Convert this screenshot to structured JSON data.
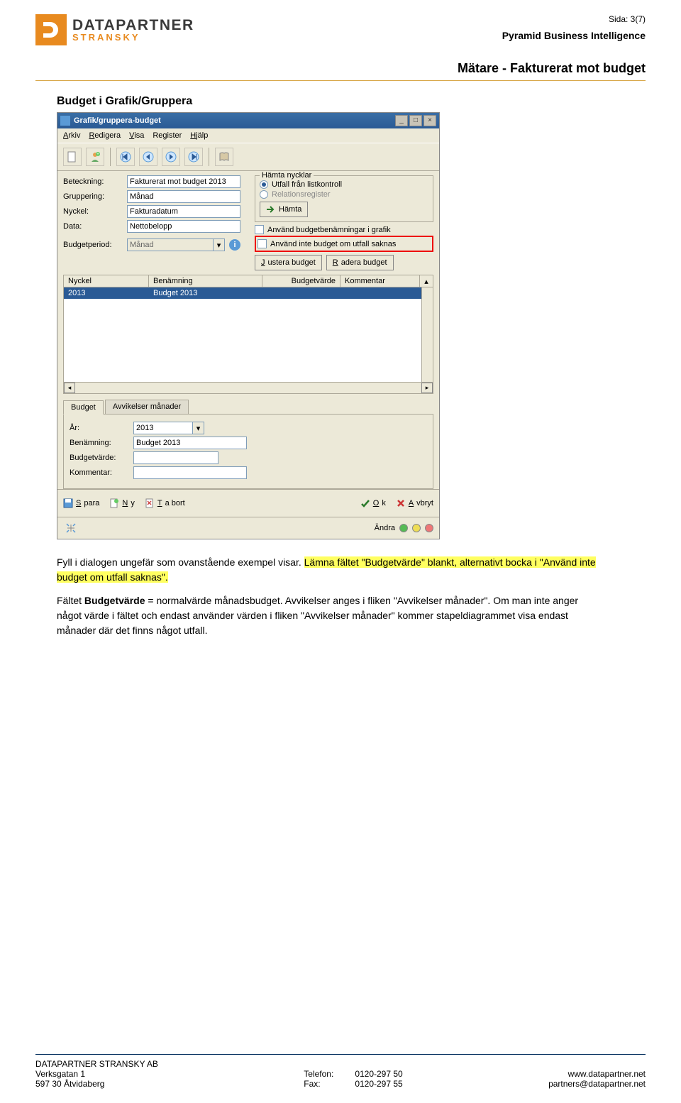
{
  "page": {
    "number": "Sida: 3(7)",
    "group": "Pyramid Business Intelligence",
    "title": "Mätare - Fakturerat mot budget"
  },
  "logo": {
    "main": "DATAPARTNER",
    "sub": "STRANSKY"
  },
  "section_title": "Budget i Grafik/Gruppera",
  "window": {
    "title": "Grafik/gruppera-budget",
    "menus": {
      "arkiv": "Arkiv",
      "redigera": "Redigera",
      "visa": "Visa",
      "register": "Register",
      "hjalp": "Hjälp"
    },
    "form_left": {
      "beteckning_label": "Beteckning:",
      "beteckning_value": "Fakturerat mot budget 2013",
      "gruppering_label": "Gruppering:",
      "gruppering_value": "Månad",
      "nyckel_label": "Nyckel:",
      "nyckel_value": "Fakturadatum",
      "data_label": "Data:",
      "data_value": "Nettobelopp",
      "budgetperiod_label": "Budgetperiod:",
      "budgetperiod_value": "Månad"
    },
    "form_right": {
      "fieldset_title": "Hämta nycklar",
      "radio1": "Utfall från listkontroll",
      "radio2": "Relationsregister",
      "hamta_btn": "Hämta",
      "chk1": "Använd budgetbenämningar i grafik",
      "chk2": "Använd inte budget om utfall saknas",
      "justera_btn": "Justera budget",
      "radera_btn": "Radera budget"
    },
    "grid": {
      "h1": "Nyckel",
      "h2": "Benämning",
      "h3": "Budgetvärde",
      "h4": "Kommentar",
      "row": {
        "c1": "2013",
        "c2": "Budget 2013",
        "c3": "",
        "c4": ""
      }
    },
    "tabs": {
      "t1": "Budget",
      "t2": "Avvikelser månader"
    },
    "bottom_form": {
      "ar_label": "År:",
      "ar_value": "2013",
      "ben_label": "Benämning:",
      "ben_value": "Budget 2013",
      "bv_label": "Budgetvärde:",
      "bv_value": "",
      "kom_label": "Kommentar:",
      "kom_value": ""
    },
    "actions": {
      "spara": "Spara",
      "ny": "Ny",
      "tabort": "Ta bort",
      "ok": "Ok",
      "avbryt": "Avbryt",
      "andra": "Ändra"
    }
  },
  "body": {
    "p1a": "Fyll i dialogen ungefär som ovanstående exempel visar. ",
    "p1b": "Lämna fältet \"Budgetvärde\" blankt, alternativt bocka i \"Använd inte budget om utfall saknas\".",
    "p2a": "Fältet ",
    "p2b": "Budgetvärde",
    "p2c": " = normalvärde månadsbudget. Avvikelser anges i fliken \"Avvikelser månader\". Om man inte anger något värde i fältet och endast använder värden i fliken \"Avvikelser månader\" kommer stapeldiagrammet visa endast månader där det finns något utfall."
  },
  "footer": {
    "company": "DATAPARTNER STRANSKY AB",
    "addr1": "Verksgatan 1",
    "addr2": "597 30 Åtvidaberg",
    "tel_label": "Telefon:",
    "tel_value": "0120-297 50",
    "fax_label": "Fax:",
    "fax_value": "0120-297 55",
    "web": "www.datapartner.net",
    "email": "partners@datapartner.net"
  }
}
